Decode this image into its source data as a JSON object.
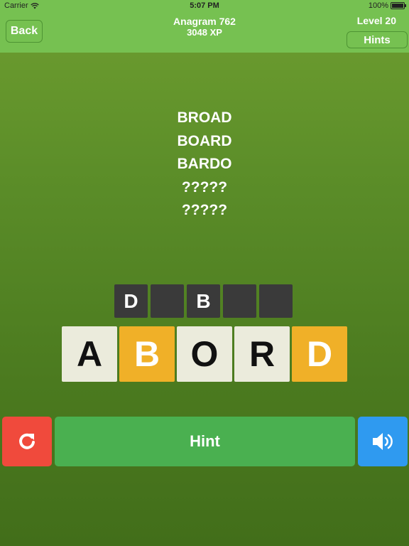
{
  "status": {
    "carrier": "Carrier",
    "time": "5:07 PM",
    "battery": "100%",
    "battery_level": 1.0
  },
  "header": {
    "back_label": "Back",
    "title": "Anagram 762",
    "xp": "3048 XP",
    "level": "Level 20",
    "hints_label": "Hints"
  },
  "found_words": [
    "BROAD",
    "BOARD",
    "BARDO",
    "?????",
    "?????"
  ],
  "answer_slots": [
    "D",
    "",
    "B",
    "",
    ""
  ],
  "letter_tiles": [
    {
      "letter": "A",
      "color": "#ebebdc"
    },
    {
      "letter": "B",
      "color": "#f0b028"
    },
    {
      "letter": "O",
      "color": "#ebebdc"
    },
    {
      "letter": "R",
      "color": "#ebebdc"
    },
    {
      "letter": "D",
      "color": "#f0b028"
    }
  ],
  "controls": {
    "refresh_icon": "refresh-icon",
    "hint_label": "Hint",
    "sound_icon": "speaker-icon",
    "refresh_color": "#f04a3c",
    "hint_color": "#4ab050",
    "sound_color": "#2f9af0"
  }
}
